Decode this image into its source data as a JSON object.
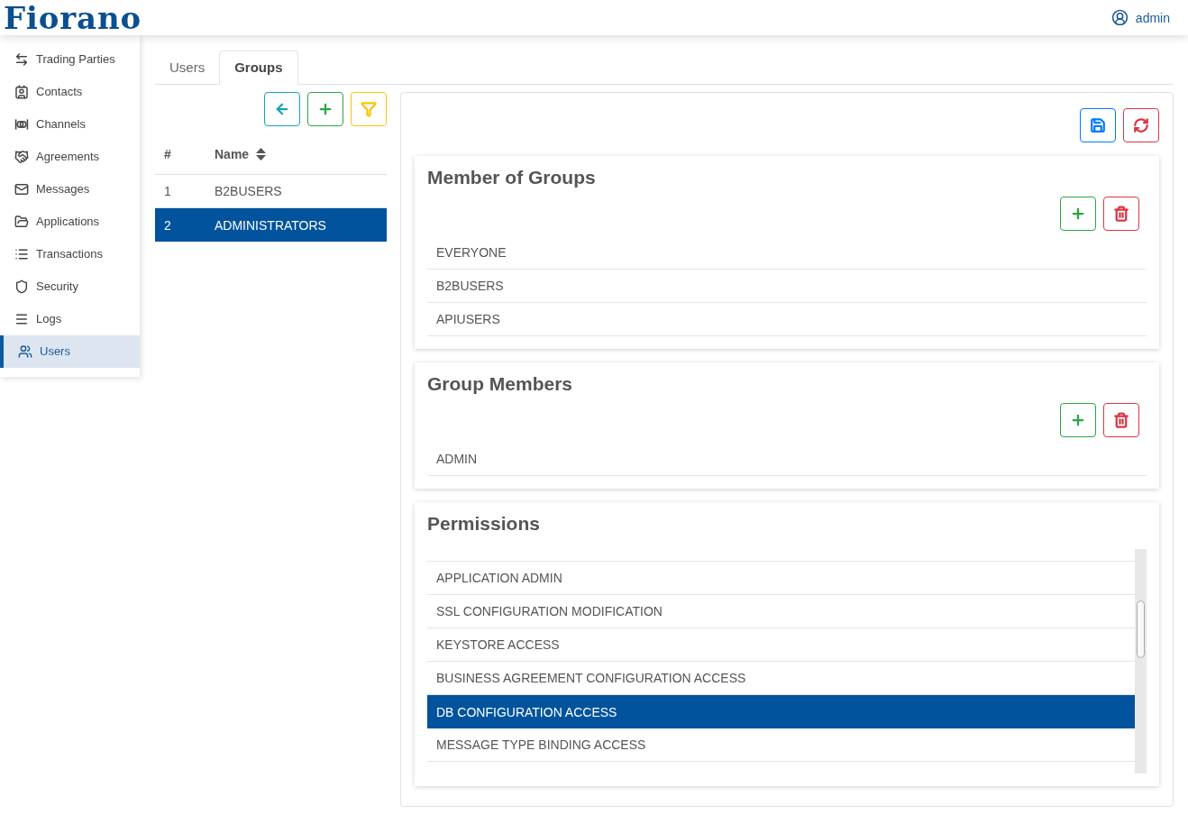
{
  "header": {
    "logo": "Fiorano",
    "user": "admin"
  },
  "sidebar": {
    "items": [
      {
        "label": "Trading Parties",
        "selected": false
      },
      {
        "label": "Contacts",
        "selected": false
      },
      {
        "label": "Channels",
        "selected": false
      },
      {
        "label": "Agreements",
        "selected": false
      },
      {
        "label": "Messages",
        "selected": false
      },
      {
        "label": "Applications",
        "selected": false
      },
      {
        "label": "Transactions",
        "selected": false
      },
      {
        "label": "Security",
        "selected": false
      },
      {
        "label": "Logs",
        "selected": false
      },
      {
        "label": "Users",
        "selected": true
      }
    ]
  },
  "tabs": [
    {
      "label": "Users",
      "selected": false
    },
    {
      "label": "Groups",
      "selected": true
    }
  ],
  "groups_table": {
    "columns": [
      "#",
      "Name"
    ],
    "rows": [
      {
        "number": "1",
        "name": "B2BUSERS",
        "selected": false
      },
      {
        "number": "2",
        "name": "ADMINISTRATORS",
        "selected": true
      }
    ]
  },
  "sections": [
    {
      "title": "Member of Groups",
      "kind": "editable",
      "items": [
        {
          "label": "EVERYONE",
          "selected": false
        },
        {
          "label": "B2BUSERS",
          "selected": false
        },
        {
          "label": "APIUSERS",
          "selected": false
        }
      ]
    },
    {
      "title": "Group Members",
      "kind": "editable",
      "items": [
        {
          "label": "ADMIN",
          "selected": false
        }
      ]
    },
    {
      "title": "Permissions",
      "kind": "scroll",
      "items": [
        {
          "label": "APPLICATION ADMIN",
          "selected": false
        },
        {
          "label": "SSL CONFIGURATION MODIFICATION",
          "selected": false
        },
        {
          "label": "KEYSTORE ACCESS",
          "selected": false
        },
        {
          "label": "BUSINESS AGREEMENT CONFIGURATION ACCESS",
          "selected": false
        },
        {
          "label": "DB CONFIGURATION ACCESS",
          "selected": true
        },
        {
          "label": "MESSAGE TYPE BINDING ACCESS",
          "selected": false
        }
      ]
    }
  ]
}
